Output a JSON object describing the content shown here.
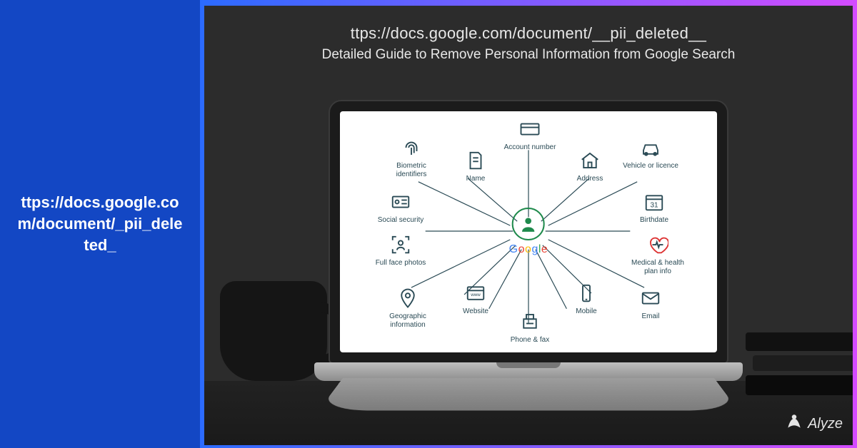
{
  "left_panel": {
    "text": "ttps://docs.google.com/document/_pii_deleted_"
  },
  "titles": {
    "url": "ttps://docs.google.com/document/__pii_deleted__",
    "subtitle": "Detailed Guide to Remove Personal Information from Google Search"
  },
  "center_label": "Google",
  "nodes": {
    "account_number": "Account number",
    "biometric": "Biometric identifiers",
    "name": "Name",
    "address": "Address",
    "vehicle": "Vehicle or licence",
    "social_security": "Social security",
    "birthdate": "Birthdate",
    "full_face": "Full face photos",
    "medical": "Medical & health plan info",
    "geographic": "Geographic information",
    "website": "Website",
    "phone_fax": "Phone & fax",
    "mobile": "Mobile",
    "email": "Email"
  },
  "watermark": "Alyze"
}
